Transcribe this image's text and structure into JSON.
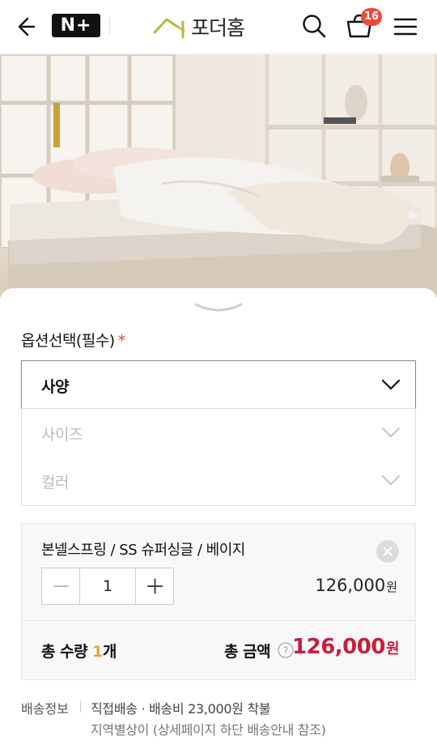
{
  "header": {
    "nplus_label": "N+",
    "brand_name": "포더홈",
    "cart_count": "16",
    "icons": [
      "back-arrow-icon",
      "search-icon",
      "cart-icon",
      "hamburger-menu-icon"
    ]
  },
  "hero": {
    "image": "product-photo-bed-mattress"
  },
  "options": {
    "title": "옵션선택(필수)",
    "required_mark": "*",
    "selects": [
      {
        "label": "사양",
        "active": true
      },
      {
        "label": "사이즈",
        "active": false
      },
      {
        "label": "컬러",
        "active": false
      }
    ]
  },
  "selected_item": {
    "name": "본넬스프링 / SS 슈퍼싱글 / 베이지",
    "quantity": "1",
    "price": "126,000",
    "price_unit": "원"
  },
  "totals": {
    "qty_prefix": "총 수량 ",
    "qty_value": "1",
    "qty_suffix": "개",
    "amount_label": "총 금액",
    "amount": "126,000",
    "amount_unit": "원"
  },
  "shipping": {
    "label": "배송정보",
    "line1": "직접배송 · 배송비 23,000원 착불",
    "line2": "지역별상이 (상세페이지 하단 배송안내 참조)"
  },
  "colors": {
    "accent_red": "#c6203c",
    "badge_red": "#f4473a",
    "qty_orange": "#e8a33c",
    "logo_green": "#a6c23a",
    "logo_orange": "#e9b24a"
  }
}
